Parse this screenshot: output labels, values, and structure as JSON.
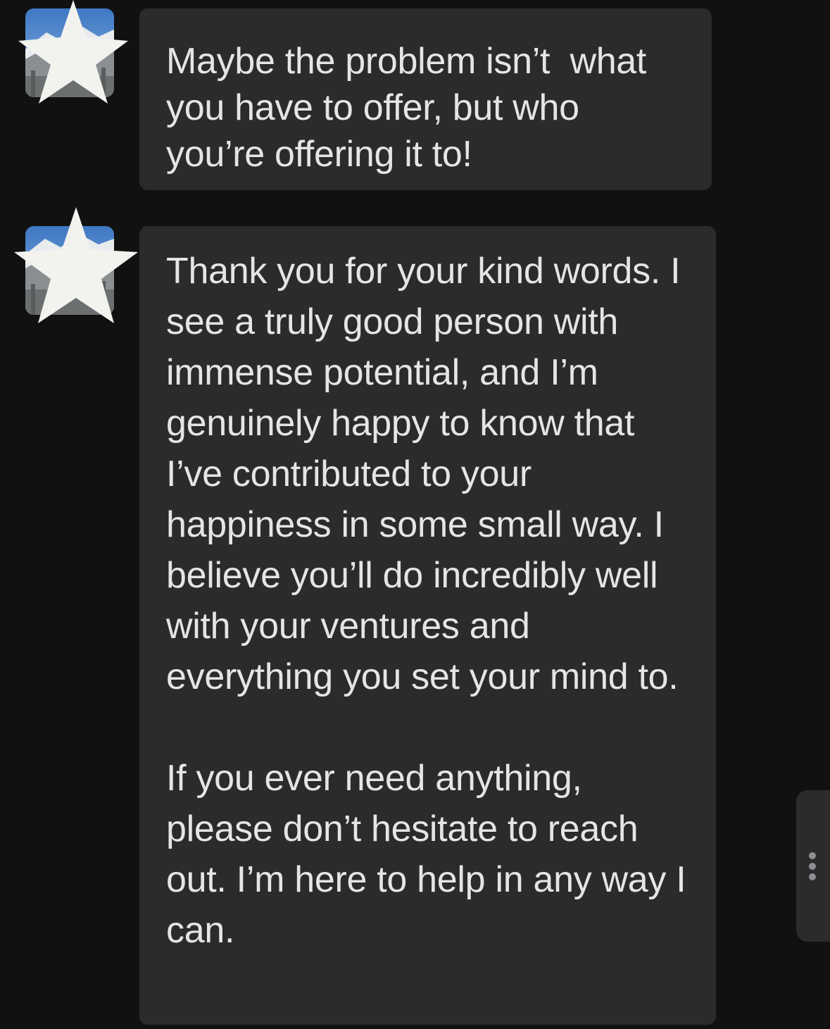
{
  "conversation": {
    "messages": [
      {
        "sender_avatar_icon": "mountain-photo-avatar",
        "redaction_icon": "star-icon",
        "text": "Maybe the problem isn’t  what you have to offer, but who you’re offering it to!"
      },
      {
        "sender_avatar_icon": "mountain-photo-avatar",
        "redaction_icon": "star-icon",
        "paragraphs": [
          "Thank you for your kind words. I see a truly good person with immense potential, and I’m genuinely happy to know that I’ve contributed to your happiness in some small way. I believe you’ll do incredibly well with your ventures and everything you set your mind to.",
          "If you ever need anything, please don’t hesitate to reach out. I’m here to help in any way I can."
        ]
      }
    ]
  },
  "side_menu": {
    "icon": "more-vertical-icon"
  },
  "colors": {
    "background": "#111112",
    "bubble": "#2b2b2c",
    "text": "#e5e5e7",
    "star": "#f2f2ee"
  }
}
